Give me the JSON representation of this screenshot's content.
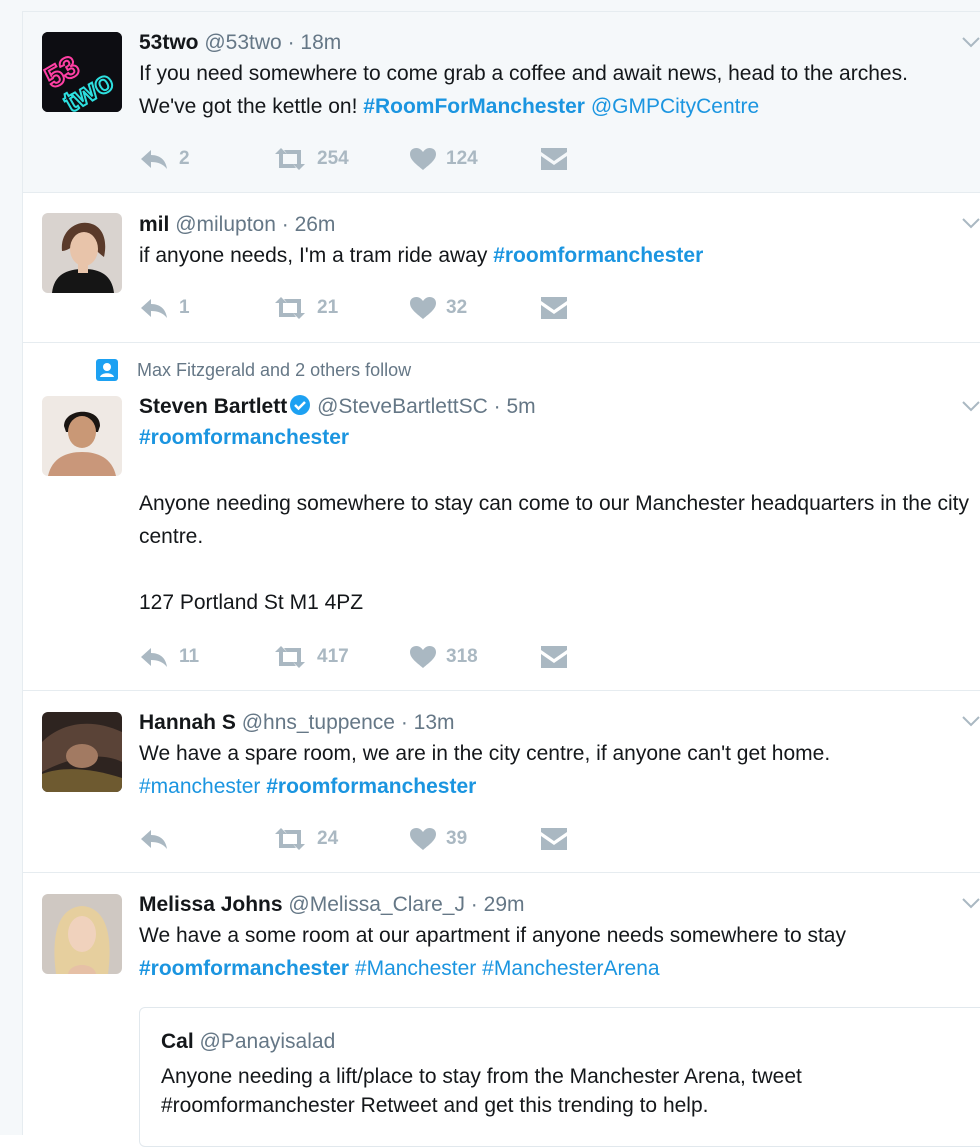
{
  "tweets": [
    {
      "name": "53two",
      "handle": "@53two",
      "time": "18m",
      "text_parts": [
        {
          "t": "If you need somewhere to come grab a coffee and await news, head to the arches. We've got the kettle on! ",
          "style": "plain"
        },
        {
          "t": "#RoomForManchester",
          "style": "hashtag-bold"
        },
        {
          "t": " ",
          "style": "plain"
        },
        {
          "t": "@GMPCityCentre",
          "style": "link"
        }
      ],
      "replies": "2",
      "retweets": "254",
      "likes": "124",
      "avatar_text": "53 two"
    },
    {
      "name": "mil",
      "handle": "@milupton",
      "time": "26m",
      "text_parts": [
        {
          "t": "if anyone needs, I'm a tram ride away ",
          "style": "plain"
        },
        {
          "t": "#roomformanchester",
          "style": "hashtag-bold"
        }
      ],
      "replies": "1",
      "retweets": "21",
      "likes": "32"
    },
    {
      "social_context": "Max Fitzgerald and 2 others follow",
      "name": "Steven Bartlett",
      "handle": "@SteveBartlettSC",
      "time": "5m",
      "hashtag_line": "#roomformanchester",
      "body_line1": "Anyone needing somewhere to stay can come to our Manchester headquarters in the city centre.",
      "body_line2": "127 Portland St M1 4PZ",
      "replies": "11",
      "retweets": "417",
      "likes": "318"
    },
    {
      "name": "Hannah S",
      "handle": "@hns_tuppence",
      "time": "13m",
      "line1": "We have a spare room, we are in the city centre, if anyone can't get home.",
      "tag1": "#manchester",
      "tag2": "#roomformanchester",
      "retweets": "24",
      "likes": "39"
    },
    {
      "name": "Melissa Johns",
      "handle": "@Melissa_Clare_J",
      "time": "29m",
      "line1": "We have a some room at our apartment if anyone needs somewhere to stay",
      "tag1": "#roomformanchester",
      "tag2": "#Manchester",
      "tag3": "#ManchesterArena",
      "quote": {
        "name": "Cal",
        "handle": "@Panayisalad",
        "line1": "Anyone needing a lift/place to stay from the Manchester Arena, tweet",
        "line2": "#roomformanchester Retweet and get this trending to help."
      }
    }
  ],
  "separator": "·",
  "colors": {
    "link": "#1b95e0",
    "muted": "#657786",
    "action": "#aab8c2",
    "highlight_bg": "#f5f8fa",
    "border": "#e6ecf0"
  },
  "icons": [
    "reply-icon",
    "retweet-icon",
    "like-icon",
    "direct-message-icon",
    "chevron-down-icon",
    "verified-badge-icon",
    "follow-context-icon"
  ]
}
